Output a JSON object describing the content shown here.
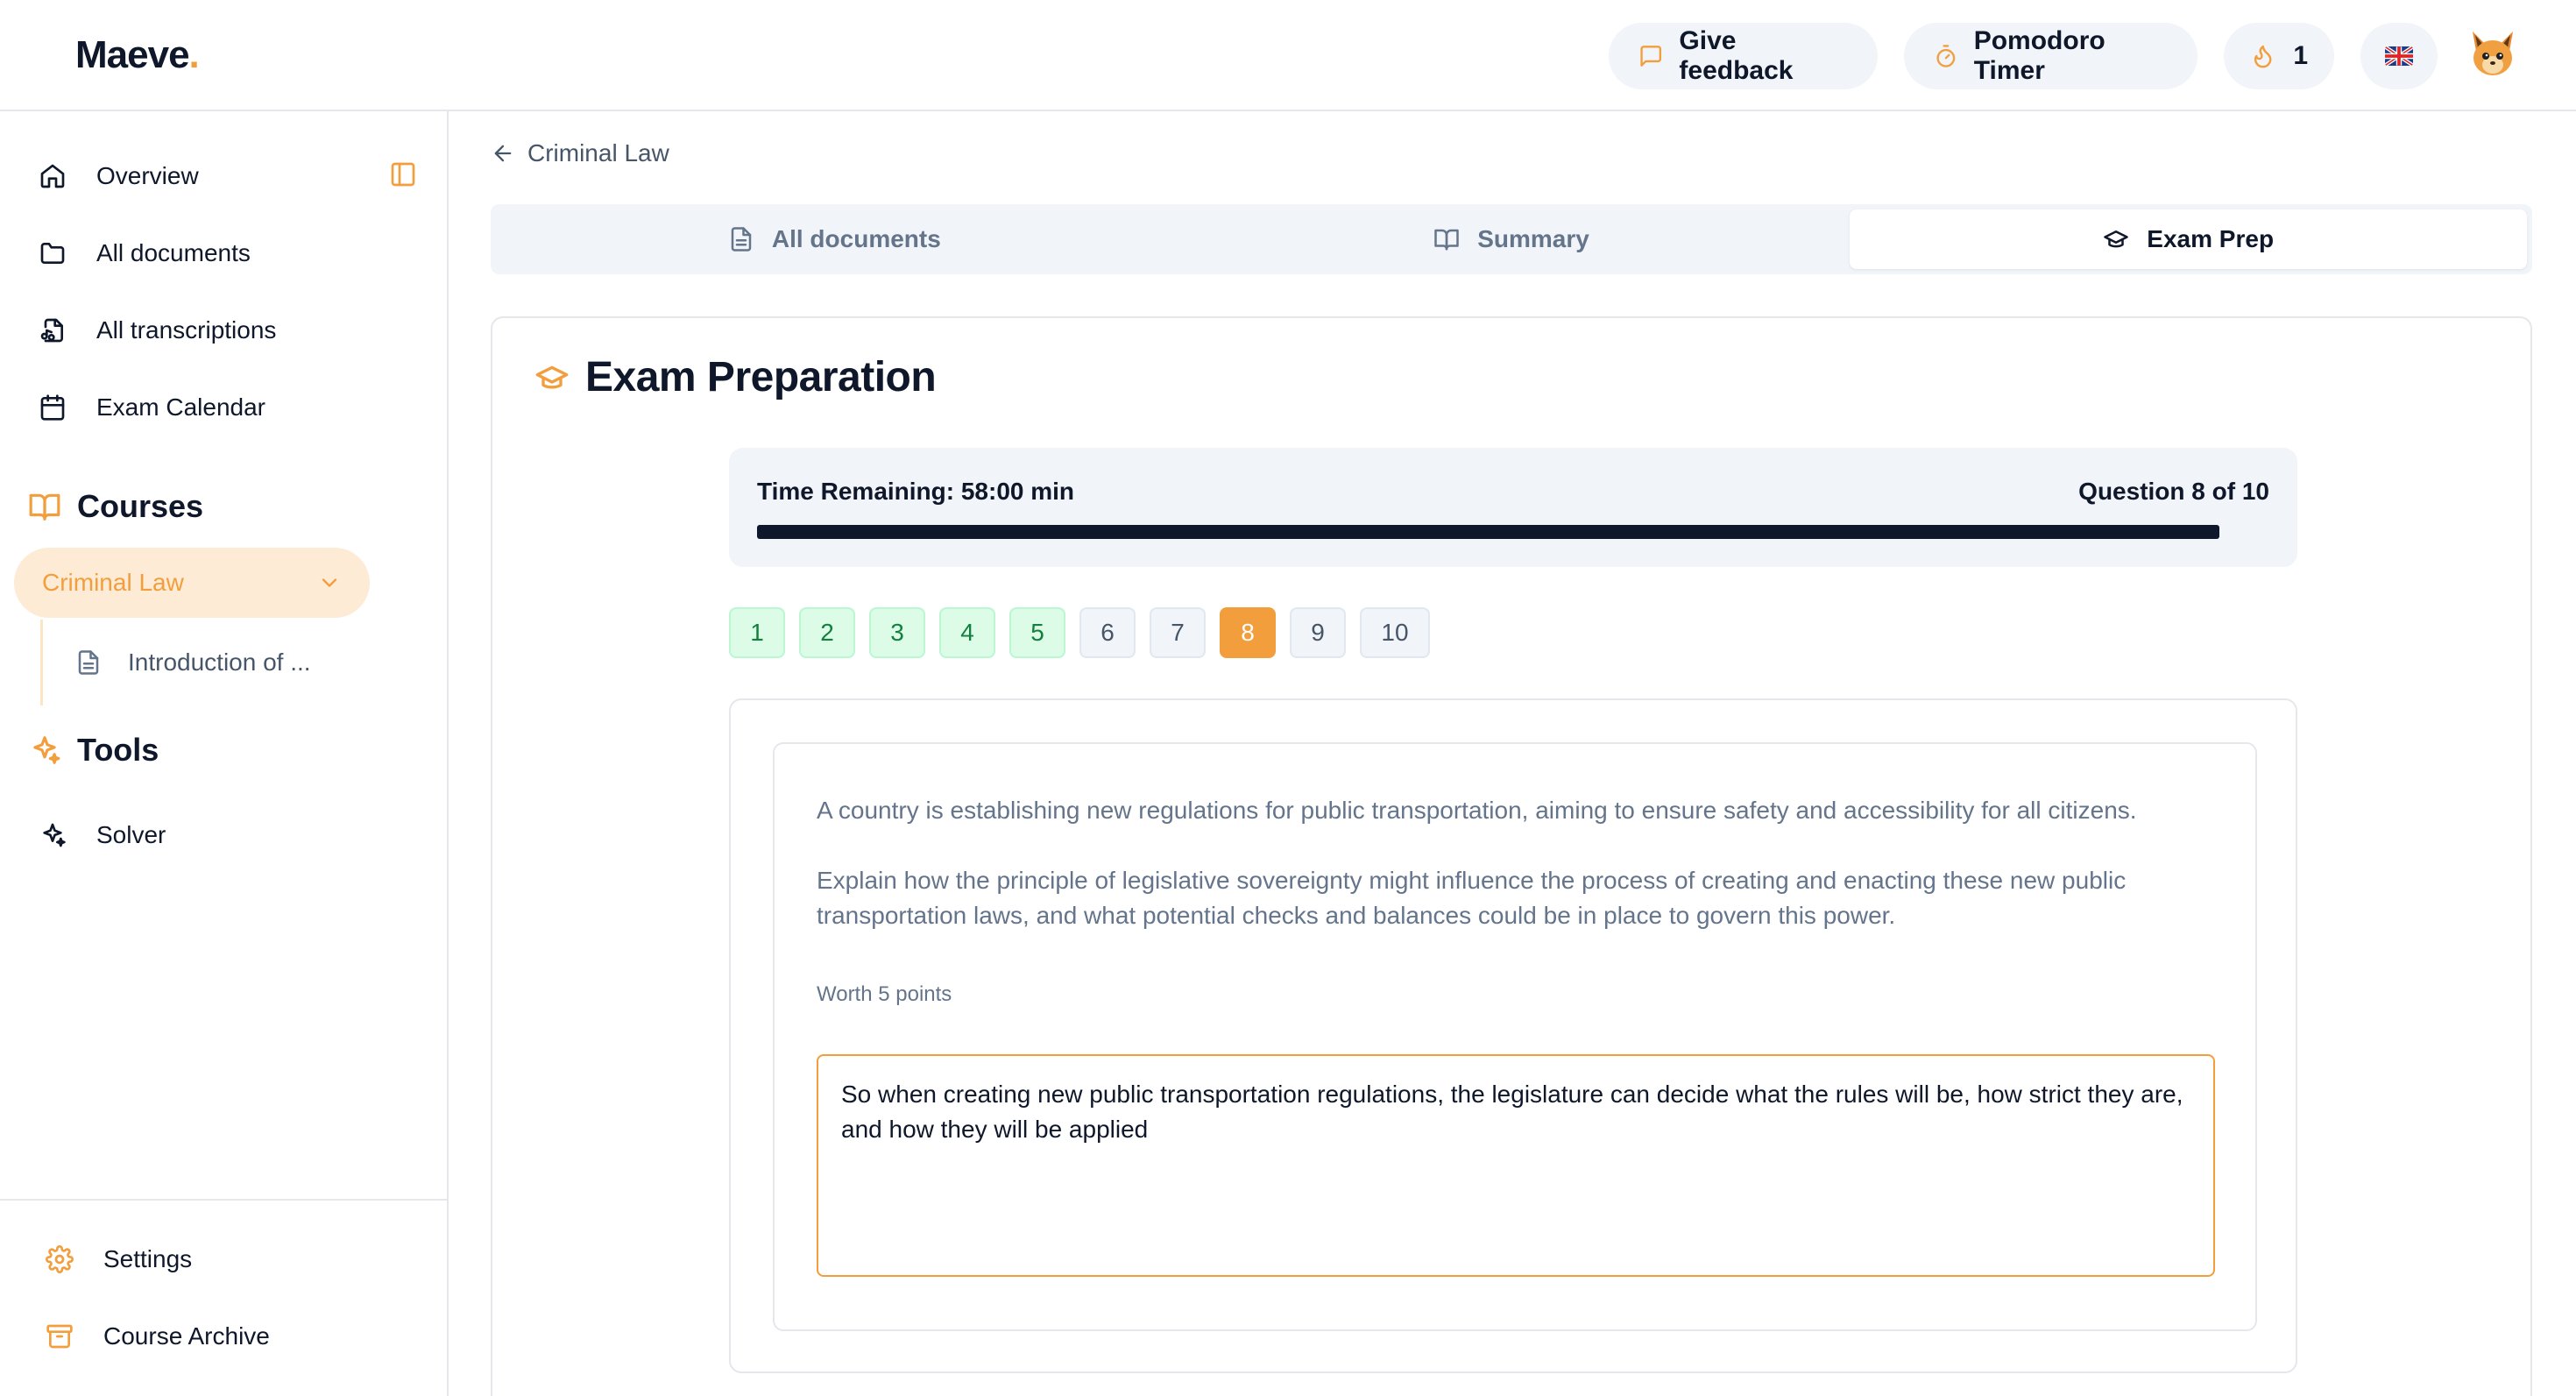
{
  "header": {
    "logo_text": "Maeve",
    "logo_dot": ".",
    "feedback_label": "Give feedback",
    "pomodoro_label": "Pomodoro Timer",
    "streak_count": "1",
    "language_flag": "uk-flag-icon",
    "avatar_icon": "fox-avatar-icon"
  },
  "sidebar": {
    "nav": [
      {
        "label": "Overview",
        "icon": "home-icon"
      },
      {
        "label": "All documents",
        "icon": "folder-icon"
      },
      {
        "label": "All transcriptions",
        "icon": "file-audio-icon"
      },
      {
        "label": "Exam Calendar",
        "icon": "calendar-icon"
      }
    ],
    "courses_heading": "Courses",
    "active_course": "Criminal Law",
    "course_docs": [
      {
        "label": "Introduction of ...",
        "icon": "file-text-icon"
      }
    ],
    "tools_heading": "Tools",
    "tools": [
      {
        "label": "Solver",
        "icon": "sparkles-icon"
      }
    ],
    "footer": [
      {
        "label": "Settings",
        "icon": "gear-icon"
      },
      {
        "label": "Course Archive",
        "icon": "archive-icon"
      }
    ]
  },
  "main": {
    "back_label": "Criminal Law",
    "tabs": [
      {
        "label": "All documents",
        "icon": "file-text-icon",
        "active": false
      },
      {
        "label": "Summary",
        "icon": "book-open-icon",
        "active": false
      },
      {
        "label": "Exam Prep",
        "icon": "graduation-cap-icon",
        "active": true
      }
    ],
    "exam": {
      "title": "Exam Preparation",
      "time_remaining": "Time Remaining: 58:00 min",
      "question_counter": "Question 8 of 10",
      "time_progress": 0.967,
      "questions": [
        {
          "label": "1",
          "state": "done"
        },
        {
          "label": "2",
          "state": "done"
        },
        {
          "label": "3",
          "state": "done"
        },
        {
          "label": "4",
          "state": "done"
        },
        {
          "label": "5",
          "state": "done"
        },
        {
          "label": "6",
          "state": "pending"
        },
        {
          "label": "7",
          "state": "pending"
        },
        {
          "label": "8",
          "state": "current"
        },
        {
          "label": "9",
          "state": "pending"
        },
        {
          "label": "10",
          "state": "pending"
        }
      ],
      "question_context": "A country is establishing new regulations for public transportation, aiming to ensure safety and accessibility for all citizens.",
      "question_prompt": "Explain how the principle of legislative sovereignty might influence the process of creating and enacting these new public transportation laws, and what potential checks and balances could be in place to govern this power.",
      "worth": "Worth 5 points",
      "answer": "So when creating new public transportation regulations, the legislature can decide what the rules will be, how strict they are, and how they will be applied"
    }
  },
  "colors": {
    "accent": "#f29e3d",
    "accent_soft": "#fdebd6",
    "done_bg": "#dcfce7",
    "done_text": "#15803d",
    "text": "#0f172a",
    "muted": "#64748b"
  }
}
